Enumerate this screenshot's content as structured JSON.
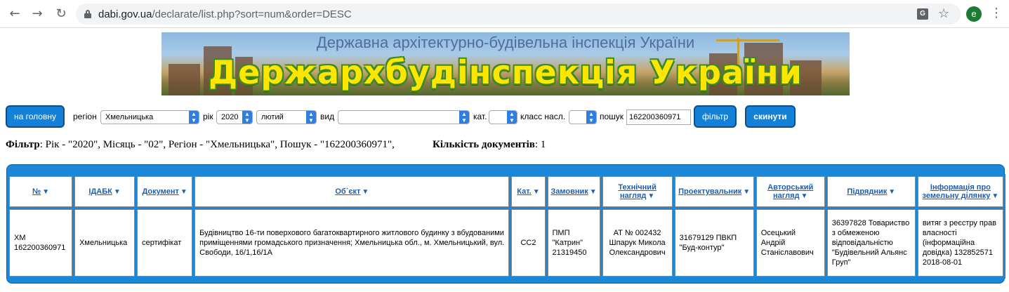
{
  "browser": {
    "url_host": "dabi.gov.ua",
    "url_path": "/declarate/list.php?sort=num&order=DESC",
    "avatar_letter": "e"
  },
  "banner": {
    "subtitle": "Державна архітектурно-будівельна інспекція України",
    "title": "Держархбудінспекція України"
  },
  "filters": {
    "home_button": "на головну",
    "region_label": "регіон",
    "region_value": "Хмельницька",
    "year_label": "рік",
    "year_value": "2020",
    "month_value": "лютий",
    "type_label": "вид",
    "type_value": "",
    "cat_label": "кат.",
    "cat_value": "",
    "class_label": "класс насл.",
    "class_value": "",
    "search_label": "пошук",
    "search_value": "162200360971",
    "filter_button": "фільтр",
    "reset_button": "скинути"
  },
  "summary": {
    "filter_label": "Фільтр",
    "filter_text": ": Рік - \"2020\", Місяць - \"02\", Регіон - \"Хмельницька\", Пошук - \"162200360971\",",
    "count_label": "Кількість документів",
    "count_value": ": 1"
  },
  "table": {
    "headers": [
      "№",
      "ІДАБК",
      "Документ",
      "Об`єкт",
      "Кат.",
      "Замовник",
      "Технічний нагляд",
      "Проектувальник",
      "Авторський нагляд",
      "Підрядник",
      "Інформація про земельну ділянку"
    ],
    "rows": [
      {
        "num": "ХМ 162200360971",
        "idabk": "Хмельницька",
        "document": "сертифікат",
        "object": "Будівництво 16-ти поверхового багатоквартирного житлового будинку з вбудованими приміщеннями громадського призначення; Хмельницька обл., м. Хмельницький, вул. Свободи, 16/1,16/1А",
        "category": "СС2",
        "customer": "ПМП \"Катрин\" 21319450",
        "tech_supervision": "АТ № 002432 Шпарук Микола Олександрович",
        "designer": "31679129 ПВКП \"Буд-контур\"",
        "author_supervision": "Осецький Андрій Станіславович",
        "contractor": "36397828 Товариство з обмеженою відповідальністю \"Будівельний Альянс Груп\"",
        "land_info": "витяг з реєстру прав власності (інформаційна довідка) 132852571 2018-08-01"
      }
    ]
  },
  "colors": {
    "accent": "#1a87d8",
    "button_border": "#0f4c8a",
    "link": "#1e5fb0",
    "banner_title": "#ffe600"
  }
}
